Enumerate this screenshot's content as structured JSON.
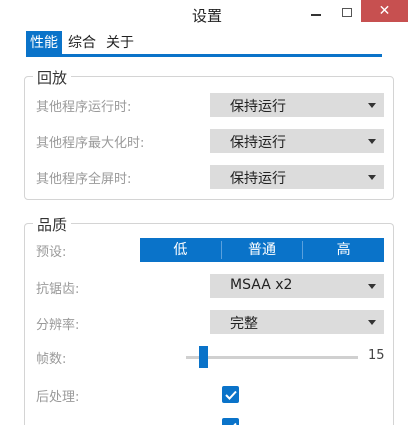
{
  "window": {
    "title": "设置",
    "close_label": "✕"
  },
  "tabs": [
    {
      "label": "性能",
      "active": true
    },
    {
      "label": "综合",
      "active": false
    },
    {
      "label": "关于",
      "active": false
    }
  ],
  "playback": {
    "title": "回放",
    "rows": [
      {
        "label": "其他程序运行时:",
        "value": "保持运行"
      },
      {
        "label": "其他程序最大化时:",
        "value": "保持运行"
      },
      {
        "label": "其他程序全屏时:",
        "value": "保持运行"
      }
    ]
  },
  "quality": {
    "title": "品质",
    "preset_label": "预设:",
    "presets": [
      "低",
      "普通",
      "高"
    ],
    "aa_label": "抗锯齿:",
    "aa_value": "MSAA x2",
    "resolution_label": "分辨率:",
    "resolution_value": "完整",
    "fps_label": "帧数:",
    "fps_value": "15",
    "fps_fraction": 0.1,
    "postprocess_label": "后处理:",
    "postprocess_checked": true
  },
  "colors": {
    "accent": "#0a73c9",
    "close": "#c75050"
  }
}
